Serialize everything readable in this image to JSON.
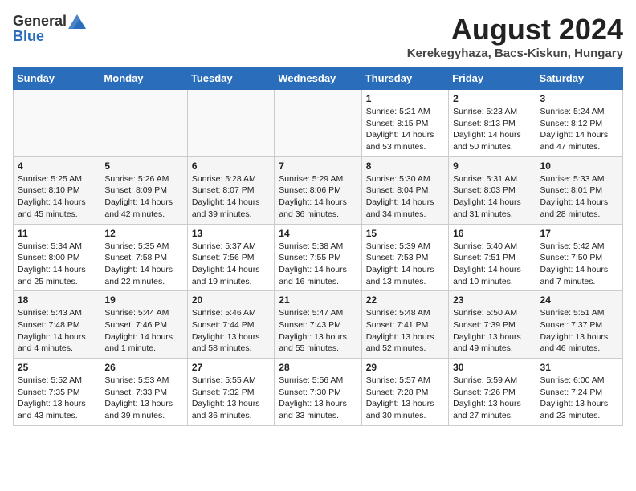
{
  "header": {
    "logo_general": "General",
    "logo_blue": "Blue",
    "month_title": "August 2024",
    "location": "Kerekegyhaza, Bacs-Kiskun, Hungary"
  },
  "weekdays": [
    "Sunday",
    "Monday",
    "Tuesday",
    "Wednesday",
    "Thursday",
    "Friday",
    "Saturday"
  ],
  "weeks": [
    [
      {
        "day": "",
        "content": ""
      },
      {
        "day": "",
        "content": ""
      },
      {
        "day": "",
        "content": ""
      },
      {
        "day": "",
        "content": ""
      },
      {
        "day": "1",
        "content": "Sunrise: 5:21 AM\nSunset: 8:15 PM\nDaylight: 14 hours\nand 53 minutes."
      },
      {
        "day": "2",
        "content": "Sunrise: 5:23 AM\nSunset: 8:13 PM\nDaylight: 14 hours\nand 50 minutes."
      },
      {
        "day": "3",
        "content": "Sunrise: 5:24 AM\nSunset: 8:12 PM\nDaylight: 14 hours\nand 47 minutes."
      }
    ],
    [
      {
        "day": "4",
        "content": "Sunrise: 5:25 AM\nSunset: 8:10 PM\nDaylight: 14 hours\nand 45 minutes."
      },
      {
        "day": "5",
        "content": "Sunrise: 5:26 AM\nSunset: 8:09 PM\nDaylight: 14 hours\nand 42 minutes."
      },
      {
        "day": "6",
        "content": "Sunrise: 5:28 AM\nSunset: 8:07 PM\nDaylight: 14 hours\nand 39 minutes."
      },
      {
        "day": "7",
        "content": "Sunrise: 5:29 AM\nSunset: 8:06 PM\nDaylight: 14 hours\nand 36 minutes."
      },
      {
        "day": "8",
        "content": "Sunrise: 5:30 AM\nSunset: 8:04 PM\nDaylight: 14 hours\nand 34 minutes."
      },
      {
        "day": "9",
        "content": "Sunrise: 5:31 AM\nSunset: 8:03 PM\nDaylight: 14 hours\nand 31 minutes."
      },
      {
        "day": "10",
        "content": "Sunrise: 5:33 AM\nSunset: 8:01 PM\nDaylight: 14 hours\nand 28 minutes."
      }
    ],
    [
      {
        "day": "11",
        "content": "Sunrise: 5:34 AM\nSunset: 8:00 PM\nDaylight: 14 hours\nand 25 minutes."
      },
      {
        "day": "12",
        "content": "Sunrise: 5:35 AM\nSunset: 7:58 PM\nDaylight: 14 hours\nand 22 minutes."
      },
      {
        "day": "13",
        "content": "Sunrise: 5:37 AM\nSunset: 7:56 PM\nDaylight: 14 hours\nand 19 minutes."
      },
      {
        "day": "14",
        "content": "Sunrise: 5:38 AM\nSunset: 7:55 PM\nDaylight: 14 hours\nand 16 minutes."
      },
      {
        "day": "15",
        "content": "Sunrise: 5:39 AM\nSunset: 7:53 PM\nDaylight: 14 hours\nand 13 minutes."
      },
      {
        "day": "16",
        "content": "Sunrise: 5:40 AM\nSunset: 7:51 PM\nDaylight: 14 hours\nand 10 minutes."
      },
      {
        "day": "17",
        "content": "Sunrise: 5:42 AM\nSunset: 7:50 PM\nDaylight: 14 hours\nand 7 minutes."
      }
    ],
    [
      {
        "day": "18",
        "content": "Sunrise: 5:43 AM\nSunset: 7:48 PM\nDaylight: 14 hours\nand 4 minutes."
      },
      {
        "day": "19",
        "content": "Sunrise: 5:44 AM\nSunset: 7:46 PM\nDaylight: 14 hours\nand 1 minute."
      },
      {
        "day": "20",
        "content": "Sunrise: 5:46 AM\nSunset: 7:44 PM\nDaylight: 13 hours\nand 58 minutes."
      },
      {
        "day": "21",
        "content": "Sunrise: 5:47 AM\nSunset: 7:43 PM\nDaylight: 13 hours\nand 55 minutes."
      },
      {
        "day": "22",
        "content": "Sunrise: 5:48 AM\nSunset: 7:41 PM\nDaylight: 13 hours\nand 52 minutes."
      },
      {
        "day": "23",
        "content": "Sunrise: 5:50 AM\nSunset: 7:39 PM\nDaylight: 13 hours\nand 49 minutes."
      },
      {
        "day": "24",
        "content": "Sunrise: 5:51 AM\nSunset: 7:37 PM\nDaylight: 13 hours\nand 46 minutes."
      }
    ],
    [
      {
        "day": "25",
        "content": "Sunrise: 5:52 AM\nSunset: 7:35 PM\nDaylight: 13 hours\nand 43 minutes."
      },
      {
        "day": "26",
        "content": "Sunrise: 5:53 AM\nSunset: 7:33 PM\nDaylight: 13 hours\nand 39 minutes."
      },
      {
        "day": "27",
        "content": "Sunrise: 5:55 AM\nSunset: 7:32 PM\nDaylight: 13 hours\nand 36 minutes."
      },
      {
        "day": "28",
        "content": "Sunrise: 5:56 AM\nSunset: 7:30 PM\nDaylight: 13 hours\nand 33 minutes."
      },
      {
        "day": "29",
        "content": "Sunrise: 5:57 AM\nSunset: 7:28 PM\nDaylight: 13 hours\nand 30 minutes."
      },
      {
        "day": "30",
        "content": "Sunrise: 5:59 AM\nSunset: 7:26 PM\nDaylight: 13 hours\nand 27 minutes."
      },
      {
        "day": "31",
        "content": "Sunrise: 6:00 AM\nSunset: 7:24 PM\nDaylight: 13 hours\nand 23 minutes."
      }
    ]
  ]
}
